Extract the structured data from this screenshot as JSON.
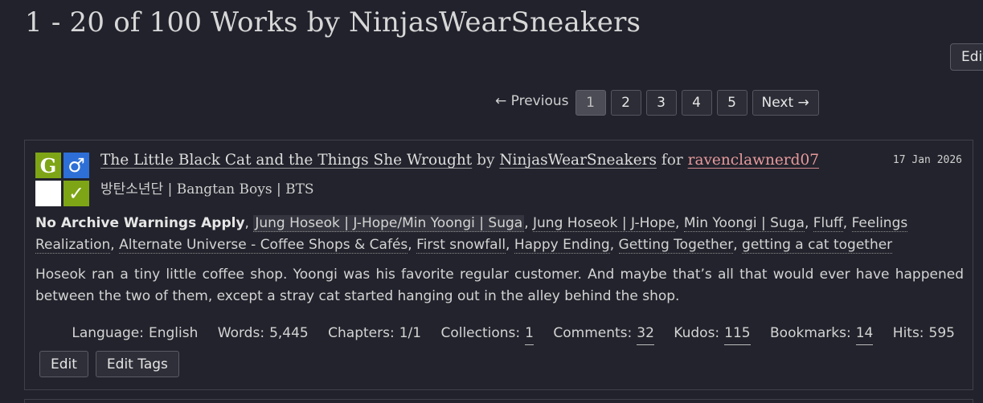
{
  "page": {
    "heading": "1 - 20 of 100 Works by NinjasWearSneakers",
    "top_edit_label": "Edit"
  },
  "pagination": {
    "previous": "← Previous",
    "pages": [
      "1",
      "2",
      "3",
      "4",
      "5"
    ],
    "current": "1",
    "next": "Next →"
  },
  "work": {
    "required_tags": {
      "rating_symbol": "G",
      "category_symbol": "♂",
      "warning_symbol": "",
      "status_symbol": "✓"
    },
    "title": "The Little Black Cat and the Things She Wrought",
    "by": "by",
    "author": "NinjasWearSneakers",
    "for": "for",
    "recipient": "ravenclawnerd07",
    "fandom": "방탄소년단 | Bangtan Boys | BTS",
    "date": "17 Jan 2026",
    "warning_tag": "No Archive Warnings Apply",
    "relationship_tag": "Jung Hoseok | J-Hope/Min Yoongi | Suga",
    "tags": [
      "Jung Hoseok | J-Hope",
      "Min Yoongi | Suga",
      "Fluff",
      "Feelings Realization",
      "Alternate Universe - Coffee Shops & Cafés",
      "First snowfall",
      "Happy Ending",
      "Getting Together",
      "getting a cat together"
    ],
    "summary": "Hoseok ran a tiny little coffee shop. Yoongi was his favorite regular customer. And maybe that’s all that would ever have happened between the two of them, except a stray cat started hanging out in the alley behind the shop.",
    "stats": {
      "language_label": "Language:",
      "language": "English",
      "words_label": "Words:",
      "words": "5,445",
      "chapters_label": "Chapters:",
      "chapters": "1/1",
      "collections_label": "Collections:",
      "collections": "1",
      "comments_label": "Comments:",
      "comments": "32",
      "kudos_label": "Kudos:",
      "kudos": "115",
      "bookmarks_label": "Bookmarks:",
      "bookmarks": "14",
      "hits_label": "Hits:",
      "hits": "595"
    },
    "actions": {
      "edit": "Edit",
      "edit_tags": "Edit Tags"
    }
  }
}
